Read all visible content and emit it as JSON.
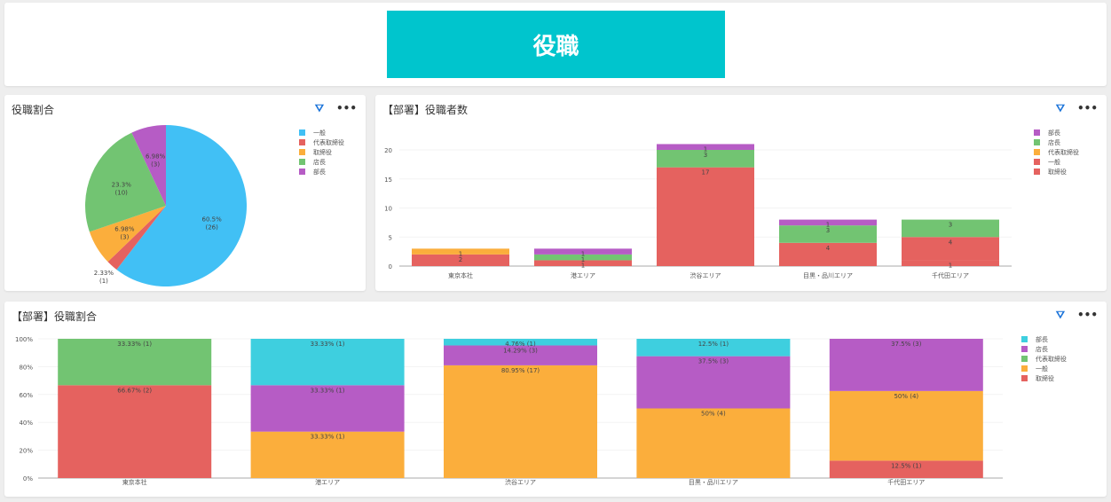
{
  "header": {
    "title": "役職",
    "banner_color": "#00c5cd"
  },
  "icons": {
    "filter": "filter-icon",
    "more": "more-icon",
    "filter_glyph": "⛛",
    "more_glyph": "•••"
  },
  "chart_data": [
    {
      "type": "pie",
      "title": "役職割合",
      "labels": [
        "一般",
        "代表取締役",
        "取締役",
        "店長",
        "部長"
      ],
      "values": [
        26,
        1,
        3,
        10,
        3
      ],
      "percent_labels": [
        "60.5%",
        "2.33%",
        "6.98%",
        "23.3%",
        "6.98%"
      ],
      "colors": [
        "#41c0f5",
        "#e5625f",
        "#fbae3c",
        "#72c472",
        "#b65cc5"
      ],
      "legend": "right"
    },
    {
      "type": "bar",
      "stacked": true,
      "title": "【部署】役職者数",
      "categories": [
        "東京本社",
        "港エリア",
        "渋谷エリア",
        "目黒・品川エリア",
        "千代田エリア"
      ],
      "series": [
        {
          "name": "取締役",
          "values": [
            2,
            0,
            0,
            0,
            1
          ],
          "color": "#e5625f"
        },
        {
          "name": "一般",
          "values": [
            0,
            1,
            17,
            4,
            4
          ],
          "color": "#e5625f"
        },
        {
          "name": "代表取締役",
          "values": [
            1,
            0,
            0,
            0,
            0
          ],
          "color": "#fbae3c"
        },
        {
          "name": "店長",
          "values": [
            0,
            1,
            3,
            3,
            3
          ],
          "color": "#72c472"
        },
        {
          "name": "部長",
          "values": [
            0,
            1,
            1,
            1,
            0
          ],
          "color": "#b65cc5"
        }
      ],
      "legend_order": [
        "部長",
        "店長",
        "代表取締役",
        "一般",
        "取締役"
      ],
      "yticks": [
        0,
        5,
        10,
        15,
        20
      ],
      "ylim": [
        0,
        22
      ],
      "legend": "right"
    },
    {
      "type": "bar",
      "stacked": true,
      "normalized": true,
      "title": "【部署】役職割合",
      "categories": [
        "東京本社",
        "港エリア",
        "渋谷エリア",
        "目黒・品川エリア",
        "千代田エリア"
      ],
      "series": [
        {
          "name": "取締役",
          "values": [
            2,
            0,
            0,
            0,
            1
          ],
          "labels": [
            "66.67% (2)",
            "",
            "",
            "",
            "12.5% (1)"
          ],
          "color": "#e5625f"
        },
        {
          "name": "一般",
          "values": [
            0,
            1,
            17,
            4,
            4
          ],
          "labels": [
            "",
            "33.33% (1)",
            "80.95% (17)",
            "50% (4)",
            "50% (4)"
          ],
          "color": "#fbae3c"
        },
        {
          "name": "代表取締役",
          "values": [
            1,
            0,
            0,
            0,
            0
          ],
          "labels": [
            "33.33% (1)",
            "",
            "",
            "",
            ""
          ],
          "color": "#72c472"
        },
        {
          "name": "店長",
          "values": [
            0,
            1,
            3,
            3,
            3
          ],
          "labels": [
            "",
            "33.33% (1)",
            "14.29% (3)",
            "37.5% (3)",
            "37.5% (3)"
          ],
          "color": "#b65cc5"
        },
        {
          "name": "部長",
          "values": [
            0,
            1,
            1,
            1,
            0
          ],
          "labels": [
            "",
            "33.33% (1)",
            "4.76% (1)",
            "12.5% (1)",
            ""
          ],
          "color": "#3ecfdf"
        }
      ],
      "legend_order": [
        "部長",
        "店長",
        "代表取締役",
        "一般",
        "取締役"
      ],
      "yticks": [
        "0%",
        "20%",
        "40%",
        "60%",
        "80%",
        "100%"
      ],
      "ylim": [
        0,
        100
      ],
      "legend": "right"
    }
  ]
}
